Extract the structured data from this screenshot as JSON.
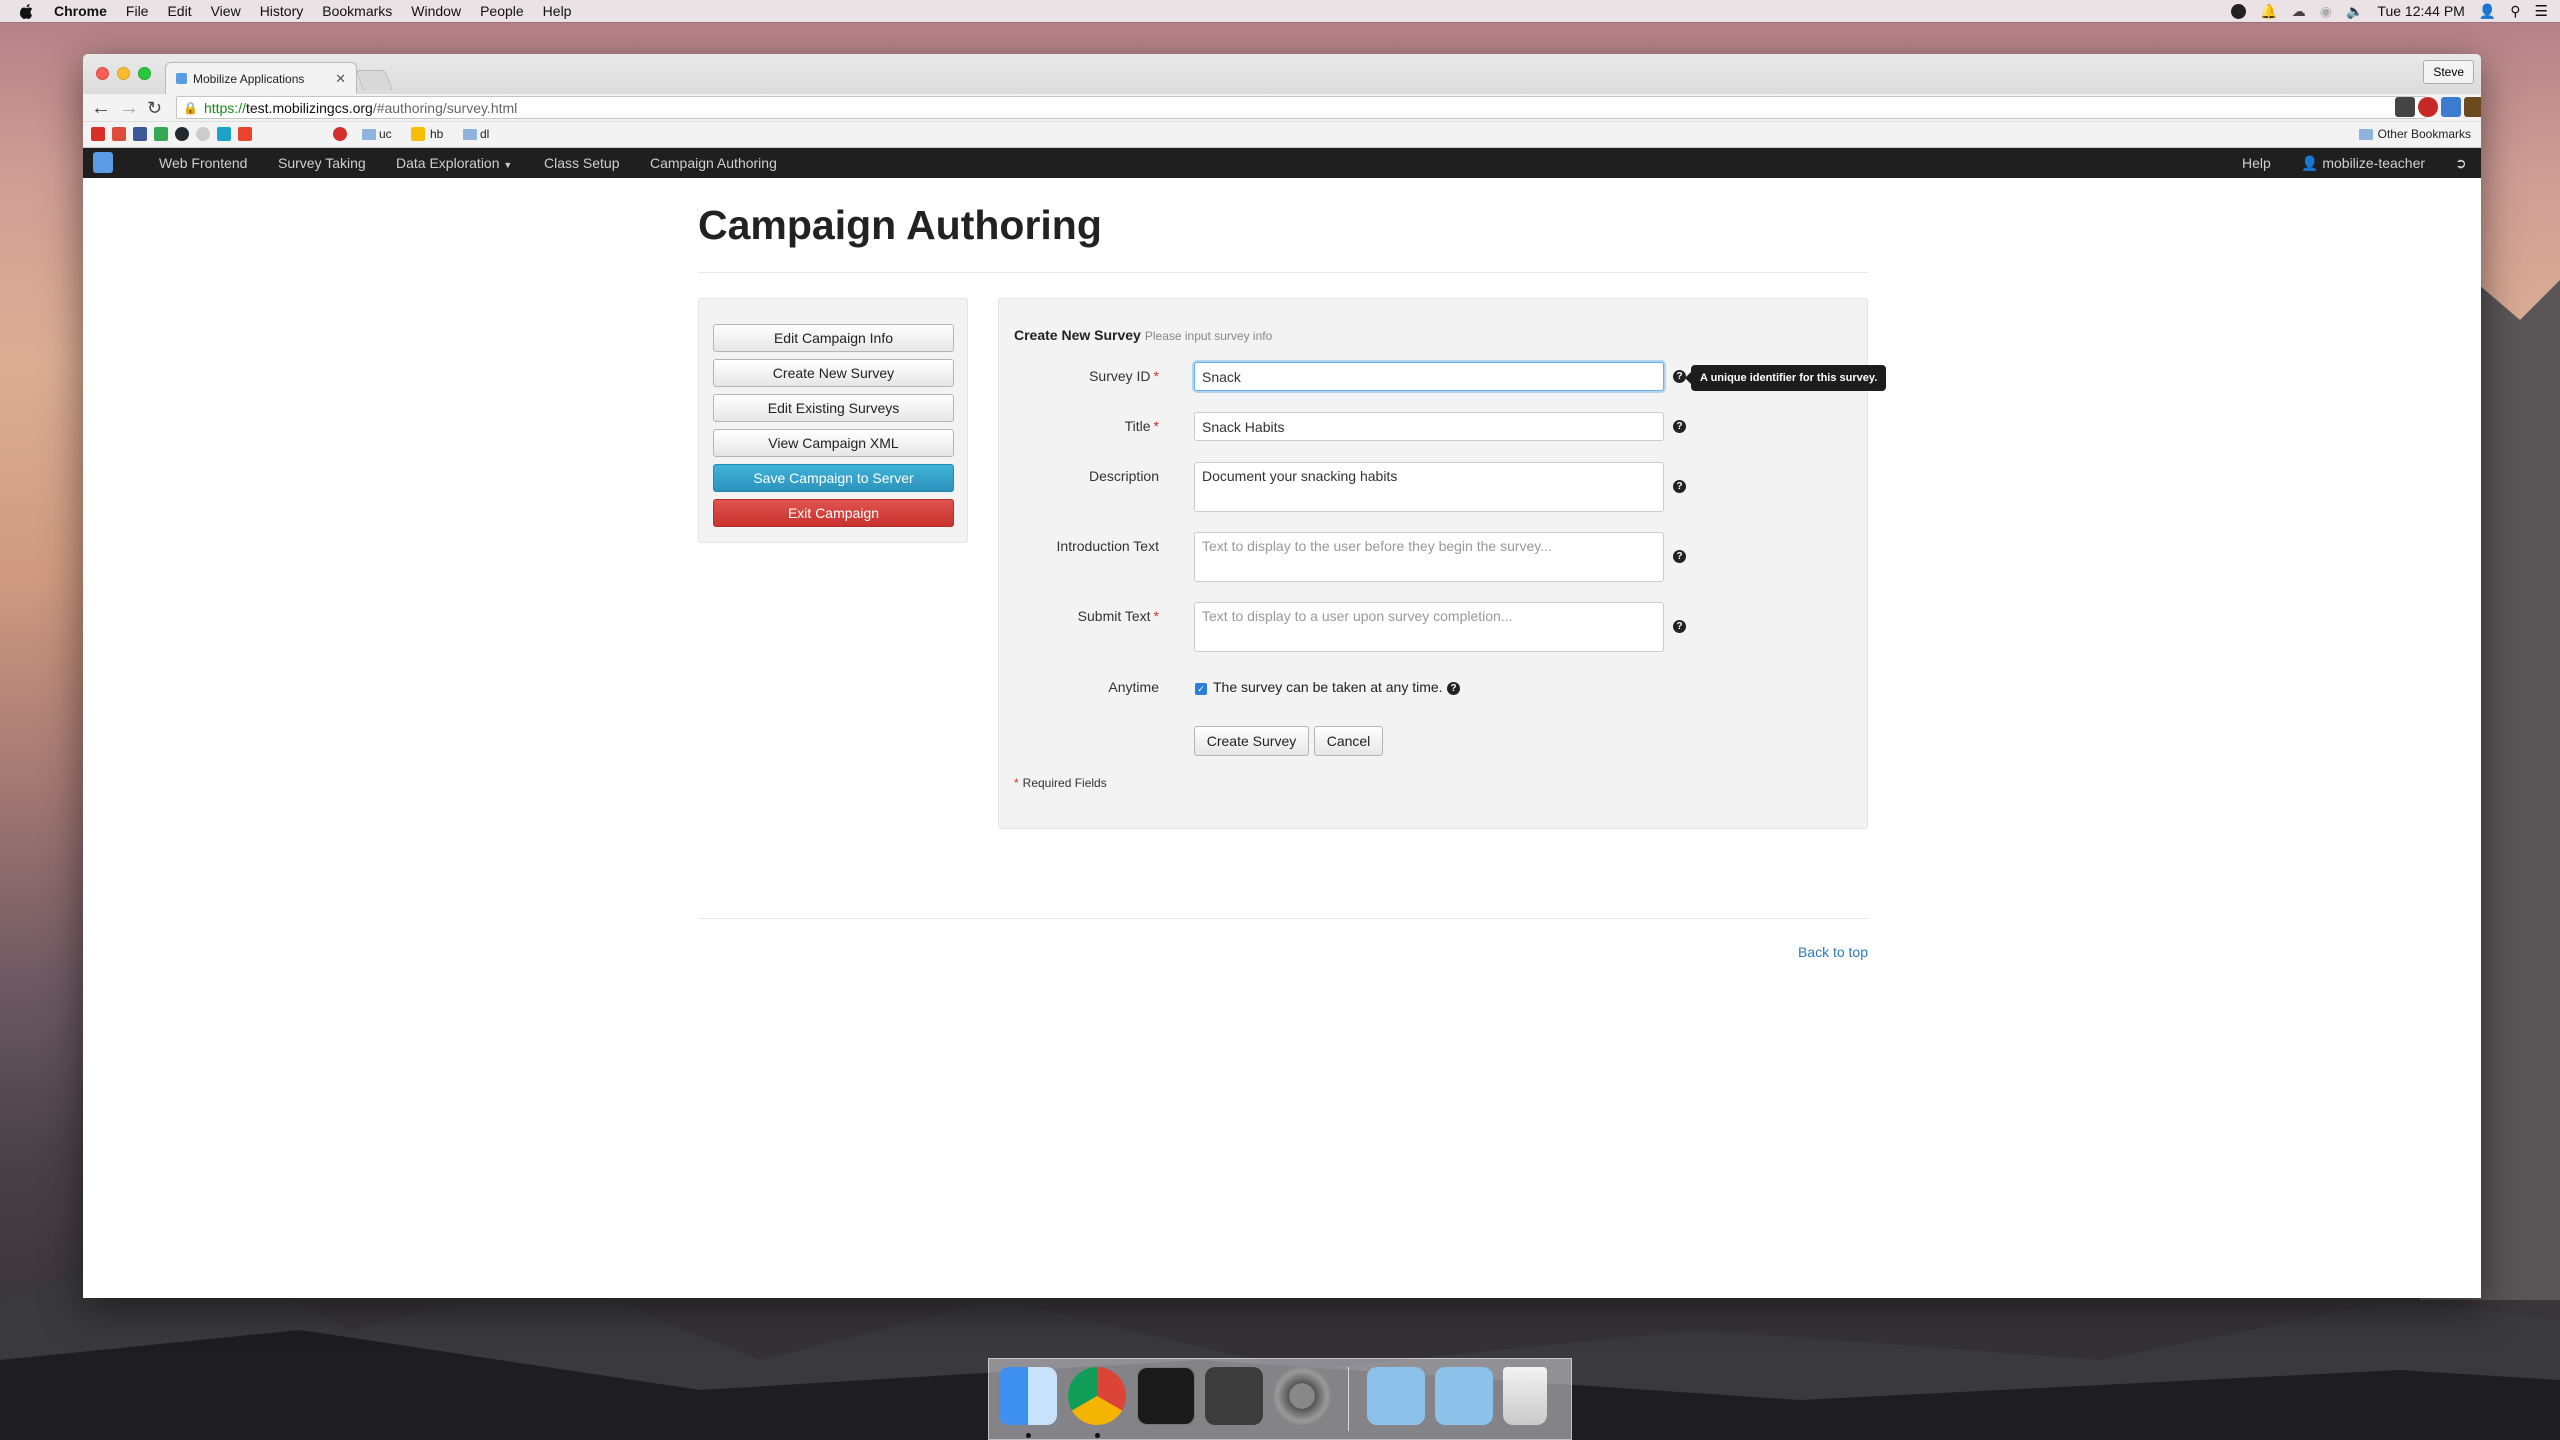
{
  "menubar": {
    "app": "Chrome",
    "items": [
      "File",
      "Edit",
      "View",
      "History",
      "Bookmarks",
      "Window",
      "People",
      "Help"
    ],
    "clock": "Tue 12:44 PM"
  },
  "browser": {
    "tab_title": "Mobilize Applications",
    "profile": "Steve",
    "url_scheme": "https://",
    "url_host": "test.mobilizingcs.org",
    "url_path": "/#authoring/survey.html",
    "bookmarks": [
      {
        "label": "uc"
      },
      {
        "label": "hb"
      },
      {
        "label": "dl"
      }
    ],
    "other_bookmarks": "Other Bookmarks"
  },
  "appnav": {
    "links": [
      "Web Frontend",
      "Survey Taking",
      "Data Exploration",
      "Class Setup",
      "Campaign Authoring"
    ],
    "help": "Help",
    "user": "mobilize-teacher"
  },
  "page": {
    "title": "Campaign Authoring",
    "sidebar_buttons": [
      "Edit Campaign Info",
      "Create New Survey",
      "Edit Existing Surveys",
      "View Campaign XML",
      "Save Campaign to Server",
      "Exit Campaign"
    ],
    "form": {
      "heading": "Create New Survey",
      "subheading": "Please input survey info",
      "survey_id_label": "Survey ID",
      "survey_id_value": "Snack",
      "tooltip": "A unique identifier for this survey.",
      "title_label": "Title",
      "title_value": "Snack Habits",
      "description_label": "Description",
      "description_value": "Document your snacking habits",
      "intro_label": "Introduction Text",
      "intro_placeholder": "Text to display to the user before they begin the survey...",
      "submit_label": "Submit Text",
      "submit_placeholder": "Text to display to a user upon survey completion...",
      "anytime_label": "Anytime",
      "anytime_text": "The survey can be taken at any time.",
      "anytime_checked": true,
      "create_button": "Create Survey",
      "cancel_button": "Cancel",
      "required_note": "Required Fields",
      "required_mark": "*"
    },
    "back_to_top": "Back to top"
  },
  "colors": {
    "save_button": "#2c93bd",
    "exit_button": "#c8322e",
    "link": "#2a7ab8",
    "navbar": "#1f1f1f"
  }
}
